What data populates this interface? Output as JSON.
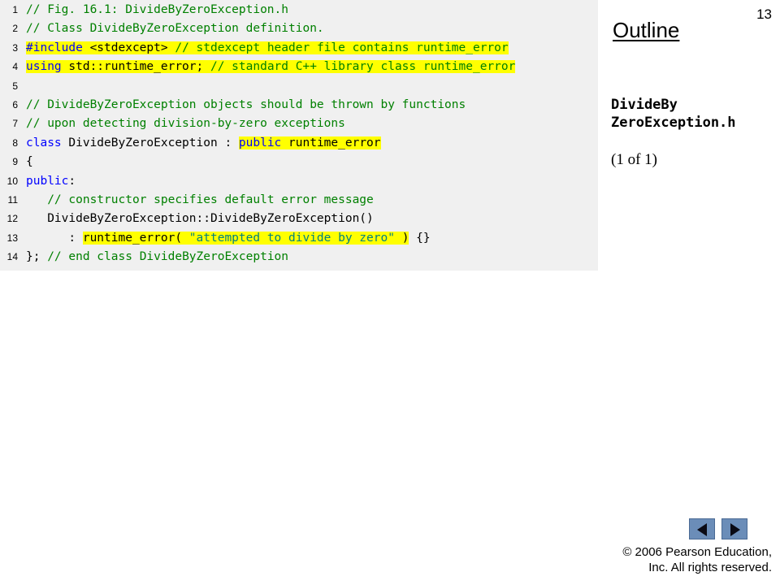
{
  "slide_number": "13",
  "outline_title": "Outline",
  "file_name": [
    "DivideBy",
    "ZeroException.h"
  ],
  "page_indicator": "(1 of 1)",
  "copyright": [
    "© 2006 Pearson Education,",
    "Inc.  All rights reserved."
  ],
  "nav": {
    "prev_icon": "triangle-left-icon",
    "next_icon": "triangle-right-icon"
  },
  "colors": {
    "comment": "#008000",
    "keyword": "#0000ff",
    "string": "#008080",
    "highlight": "#ffff00",
    "panel": "#f0f0f0"
  },
  "code_lines": [
    {
      "n": "1",
      "segs": [
        {
          "t": "// Fig. 16.1: DivideByZeroException.h",
          "c": "comment"
        }
      ]
    },
    {
      "n": "2",
      "segs": [
        {
          "t": "// Class DivideByZeroException definition.",
          "c": "comment"
        }
      ]
    },
    {
      "n": "3",
      "segs": [
        {
          "t": "#include",
          "c": "kw",
          "hl": true
        },
        {
          "t": " <stdexcept> ",
          "c": "plain",
          "hl": true
        },
        {
          "t": "// stdexcept header file contains runtime_error",
          "c": "comment",
          "hl": true
        }
      ]
    },
    {
      "n": "4",
      "segs": [
        {
          "t": "using",
          "c": "kw",
          "hl": true
        },
        {
          "t": " std::runtime_error; ",
          "c": "plain",
          "hl": true
        },
        {
          "t": "// standard C++ library class runtime_error",
          "c": "comment",
          "hl": true
        }
      ]
    },
    {
      "n": "5",
      "segs": []
    },
    {
      "n": "6",
      "segs": [
        {
          "t": "// DivideByZeroException objects should be thrown by functions",
          "c": "comment"
        }
      ]
    },
    {
      "n": "7",
      "segs": [
        {
          "t": "// upon detecting division-by-zero exceptions",
          "c": "comment"
        }
      ]
    },
    {
      "n": "8",
      "segs": [
        {
          "t": "class",
          "c": "kw"
        },
        {
          "t": " DivideByZeroException : ",
          "c": "plain"
        },
        {
          "t": "public",
          "c": "kw",
          "hl": true
        },
        {
          "t": " runtime_error",
          "c": "plain",
          "hl": true
        }
      ]
    },
    {
      "n": "9",
      "segs": [
        {
          "t": "{",
          "c": "plain"
        }
      ]
    },
    {
      "n": "10",
      "segs": [
        {
          "t": "public",
          "c": "kw"
        },
        {
          "t": ":",
          "c": "plain"
        }
      ]
    },
    {
      "n": "11",
      "segs": [
        {
          "t": "   ",
          "c": "plain"
        },
        {
          "t": "// constructor specifies default error message",
          "c": "comment"
        }
      ]
    },
    {
      "n": "12",
      "segs": [
        {
          "t": "   DivideByZeroException::DivideByZeroException()",
          "c": "plain"
        }
      ]
    },
    {
      "n": "13",
      "segs": [
        {
          "t": "      : ",
          "c": "plain"
        },
        {
          "t": "runtime_error( ",
          "c": "plain",
          "hl": true
        },
        {
          "t": "\"attempted to divide by zero\"",
          "c": "str",
          "hl": true
        },
        {
          "t": " )",
          "c": "plain",
          "hl": true
        },
        {
          "t": " {}",
          "c": "plain"
        }
      ]
    },
    {
      "n": "14",
      "segs": [
        {
          "t": "}; ",
          "c": "plain"
        },
        {
          "t": "// end class DivideByZeroException",
          "c": "comment"
        }
      ]
    }
  ]
}
